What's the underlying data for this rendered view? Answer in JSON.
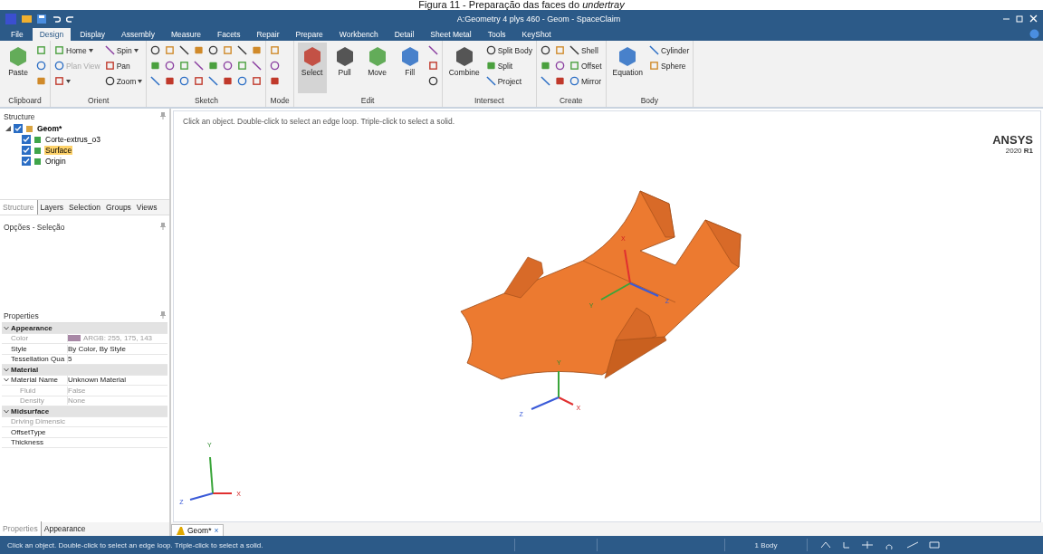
{
  "caption": "Figura 11 - Preparação das faces do *undertray*",
  "window": {
    "title": "A:Geometry 4 plys 460 - Geom - SpaceClaim"
  },
  "ribbon_tabs": [
    {
      "label": "File",
      "selected": false
    },
    {
      "label": "Design",
      "selected": true
    },
    {
      "label": "Display",
      "selected": false
    },
    {
      "label": "Assembly",
      "selected": false
    },
    {
      "label": "Measure",
      "selected": false
    },
    {
      "label": "Facets",
      "selected": false
    },
    {
      "label": "Repair",
      "selected": false
    },
    {
      "label": "Prepare",
      "selected": false
    },
    {
      "label": "Workbench",
      "selected": false
    },
    {
      "label": "Detail",
      "selected": false
    },
    {
      "label": "Sheet Metal",
      "selected": false
    },
    {
      "label": "Tools",
      "selected": false
    },
    {
      "label": "KeyShot",
      "selected": false
    }
  ],
  "ribbon_groups": [
    {
      "label": "Clipboard",
      "items": [
        {
          "kind": "large",
          "label": "Paste"
        },
        {
          "kind": "icon"
        },
        {
          "kind": "icon"
        },
        {
          "kind": "icon"
        }
      ]
    },
    {
      "label": "Orient",
      "items": [
        {
          "kind": "small",
          "label": "Home",
          "dropdown": true
        },
        {
          "kind": "small",
          "label": "Plan View",
          "disabled": true
        },
        {
          "kind": "icon",
          "dropdown": true
        },
        {
          "kind": "small",
          "label": "Spin",
          "dropdown": true
        },
        {
          "kind": "small",
          "label": "Pan"
        },
        {
          "kind": "small",
          "label": "Zoom",
          "dropdown": true
        }
      ]
    },
    {
      "label": "Sketch",
      "items": [
        {
          "kind": "icon"
        },
        {
          "kind": "icon"
        },
        {
          "kind": "icon"
        },
        {
          "kind": "icon"
        },
        {
          "kind": "icon"
        },
        {
          "kind": "icon"
        },
        {
          "kind": "icon"
        },
        {
          "kind": "icon"
        },
        {
          "kind": "icon"
        },
        {
          "kind": "icon"
        },
        {
          "kind": "icon"
        },
        {
          "kind": "icon"
        },
        {
          "kind": "icon"
        },
        {
          "kind": "icon"
        },
        {
          "kind": "icon"
        },
        {
          "kind": "icon"
        },
        {
          "kind": "icon"
        },
        {
          "kind": "icon"
        },
        {
          "kind": "icon"
        },
        {
          "kind": "icon"
        },
        {
          "kind": "icon"
        },
        {
          "kind": "icon"
        },
        {
          "kind": "icon"
        },
        {
          "kind": "icon"
        }
      ]
    },
    {
      "label": "Mode",
      "items": [
        {
          "kind": "icon"
        },
        {
          "kind": "icon"
        },
        {
          "kind": "icon"
        }
      ]
    },
    {
      "label": "Edit",
      "items": [
        {
          "kind": "large",
          "label": "Select",
          "selected": true
        },
        {
          "kind": "large",
          "label": "Pull",
          "selected": false
        },
        {
          "kind": "large",
          "label": "Move",
          "selected": false
        },
        {
          "kind": "large",
          "label": "Fill",
          "selected": false
        },
        {
          "kind": "icon"
        },
        {
          "kind": "icon"
        },
        {
          "kind": "icon"
        }
      ]
    },
    {
      "label": "Intersect",
      "items": [
        {
          "kind": "large",
          "label": "Combine"
        },
        {
          "kind": "small",
          "label": "Split Body"
        },
        {
          "kind": "small",
          "label": "Split"
        },
        {
          "kind": "small",
          "label": "Project"
        }
      ]
    },
    {
      "label": "Create",
      "items": [
        {
          "kind": "icon"
        },
        {
          "kind": "icon"
        },
        {
          "kind": "icon"
        },
        {
          "kind": "icon"
        },
        {
          "kind": "icon"
        },
        {
          "kind": "icon"
        },
        {
          "kind": "small",
          "label": "Shell"
        },
        {
          "kind": "small",
          "label": "Offset"
        },
        {
          "kind": "small",
          "label": "Mirror"
        }
      ]
    },
    {
      "label": "Body",
      "items": [
        {
          "kind": "large",
          "label": "Equation"
        },
        {
          "kind": "small",
          "label": "Cylinder"
        },
        {
          "kind": "small",
          "label": "Sphere"
        }
      ]
    }
  ],
  "structure": {
    "title": "Structure",
    "tree": [
      {
        "label": "Geom*",
        "checked": true,
        "expanded": true,
        "selected": false,
        "children": [
          {
            "label": "Corte-extrus_o3",
            "checked": true,
            "selected": false
          },
          {
            "label": "Surface",
            "checked": true,
            "selected": true
          },
          {
            "label": "Origin",
            "checked": true,
            "selected": false
          }
        ]
      }
    ]
  },
  "panel_tabs": [
    {
      "label": "Structure",
      "selected": true
    },
    {
      "label": "Layers",
      "selected": false
    },
    {
      "label": "Selection",
      "selected": false
    },
    {
      "label": "Groups",
      "selected": false
    },
    {
      "label": "Views",
      "selected": false
    }
  ],
  "options_panel": {
    "title": "Opções - Seleção"
  },
  "properties": {
    "title": "Properties",
    "rows": [
      {
        "kind": "category",
        "label": "Appearance",
        "expanded": true
      },
      {
        "kind": "property",
        "label": "Color",
        "value": "ARGB: 255, 175, 143",
        "disabled": true,
        "color": "#a888a6"
      },
      {
        "kind": "property",
        "label": "Style",
        "value": "By Color, By Style",
        "disabled": false
      },
      {
        "kind": "property",
        "label": "Tessellation Qua",
        "value": "5",
        "disabled": false
      },
      {
        "kind": "category",
        "label": "Material",
        "expanded": true
      },
      {
        "kind": "property",
        "label": "Material Name",
        "value": "Unknown Material",
        "disabled": false,
        "expanded": true
      },
      {
        "kind": "subproperty",
        "label": "Fluid",
        "value": "False",
        "disabled": true
      },
      {
        "kind": "subproperty",
        "label": "Density",
        "value": "None",
        "disabled": true
      },
      {
        "kind": "category",
        "label": "Midsurface",
        "expanded": true
      },
      {
        "kind": "property",
        "label": "Driving Dimensic",
        "disabled": true
      },
      {
        "kind": "property",
        "label": "OffsetType",
        "disabled": false
      },
      {
        "kind": "property",
        "label": "Thickness",
        "disabled": false
      }
    ]
  },
  "bottom_tabs": [
    {
      "label": "Properties",
      "selected": true
    },
    {
      "label": "Appearance",
      "selected": false
    }
  ],
  "viewport": {
    "hint": "Click an object. Double-click to select an edge loop. Triple-click to select a solid.",
    "logo": "ANSYS",
    "version": "2020 **R1**",
    "triads": [
      {
        "x_label": "X",
        "y_label": "Y",
        "z_label": "Z"
      },
      {
        "x_label": "X",
        "y_label": "Y",
        "z_label": "Z"
      },
      {
        "x_label": "X",
        "y_label": "Y",
        "z_label": "Z"
      }
    ]
  },
  "document_tabs": [
    {
      "label": "Geom*",
      "selected": true,
      "close": "×"
    }
  ],
  "status_bar": {
    "message": "Click an object. Double-click to select an edge loop. Triple-click to select a solid.",
    "selection": "1 Body"
  }
}
